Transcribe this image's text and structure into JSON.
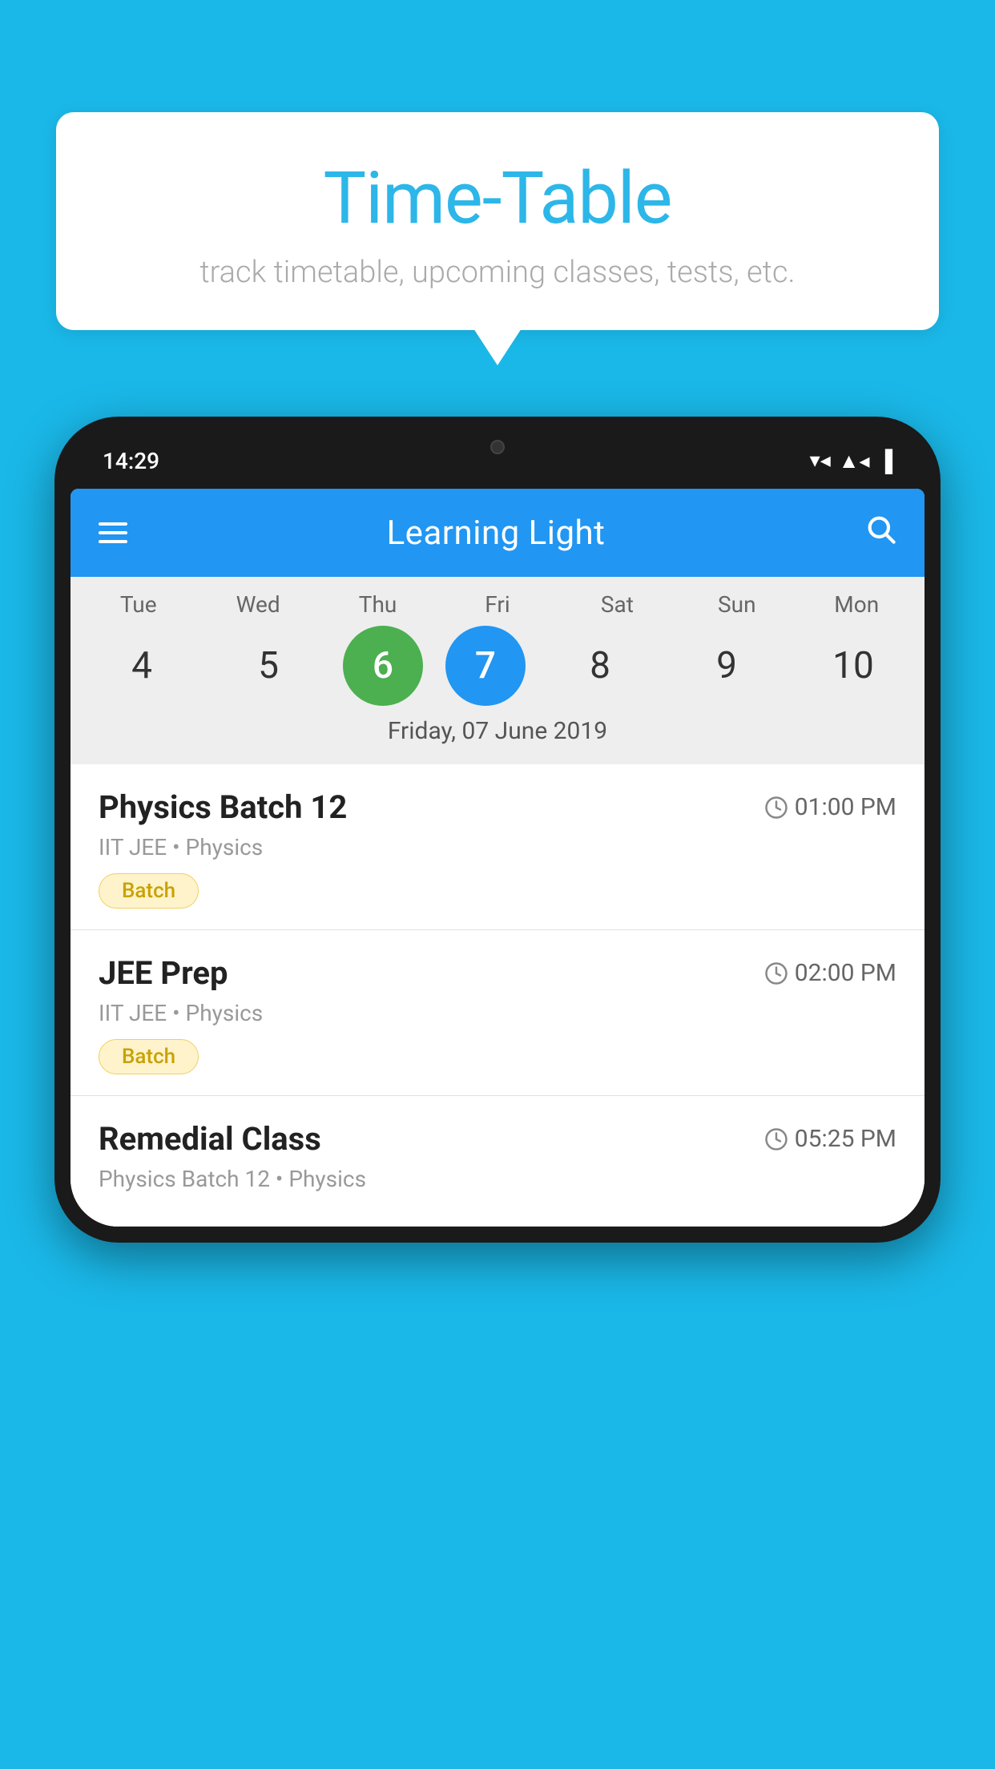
{
  "background": {
    "color": "#1ab8e8"
  },
  "speech_bubble": {
    "title": "Time-Table",
    "subtitle": "track timetable, upcoming classes, tests, etc."
  },
  "phone": {
    "status_bar": {
      "time": "14:29",
      "wifi": "▼▲",
      "signal": "▲",
      "battery": "▌"
    },
    "app_bar": {
      "title": "Learning Light",
      "menu_icon": "menu",
      "search_icon": "search"
    },
    "calendar": {
      "days": [
        {
          "label": "Tue",
          "number": "4"
        },
        {
          "label": "Wed",
          "number": "5"
        },
        {
          "label": "Thu",
          "number": "6",
          "state": "today"
        },
        {
          "label": "Fri",
          "number": "7",
          "state": "selected"
        },
        {
          "label": "Sat",
          "number": "8"
        },
        {
          "label": "Sun",
          "number": "9"
        },
        {
          "label": "Mon",
          "number": "10"
        }
      ],
      "selected_date_label": "Friday, 07 June 2019"
    },
    "schedule_items": [
      {
        "title": "Physics Batch 12",
        "time": "01:00 PM",
        "subtitle": "IIT JEE • Physics",
        "tag": "Batch"
      },
      {
        "title": "JEE Prep",
        "time": "02:00 PM",
        "subtitle": "IIT JEE • Physics",
        "tag": "Batch"
      },
      {
        "title": "Remedial Class",
        "time": "05:25 PM",
        "subtitle": "Physics Batch 12 • Physics",
        "tag": ""
      }
    ]
  }
}
